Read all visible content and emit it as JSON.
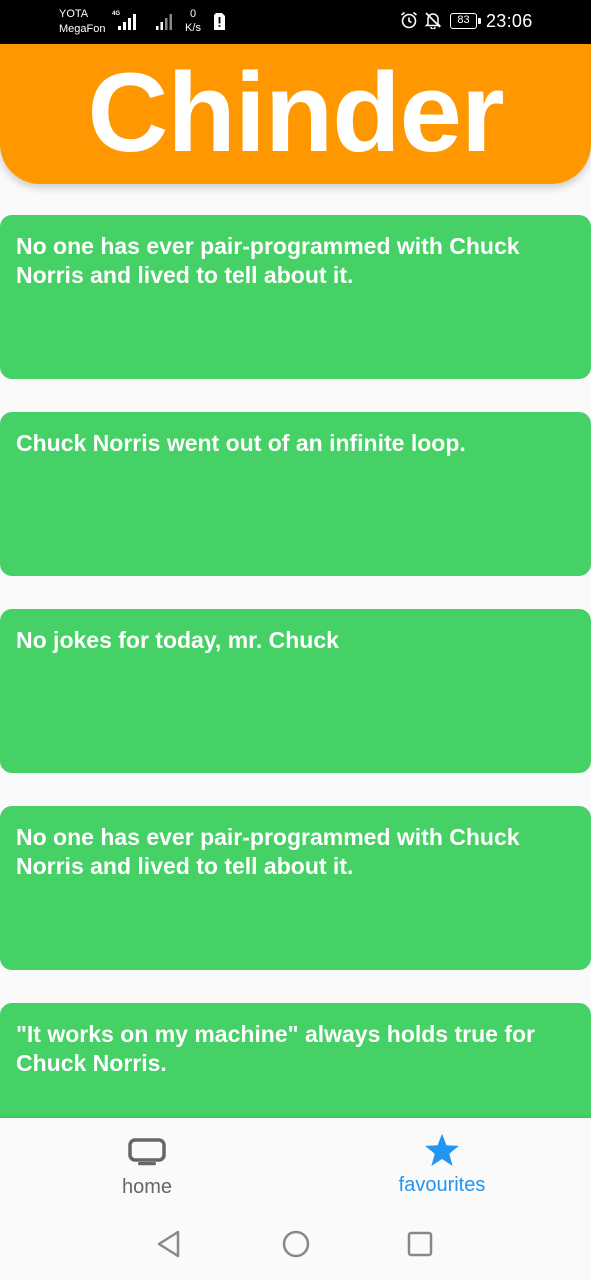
{
  "status_bar": {
    "carrier_1": "YOTA",
    "carrier_2": "MegaFon",
    "network_type": "4G",
    "speed_value": "0",
    "speed_unit": "K/s",
    "battery": "83",
    "time": "23:06",
    "icons": [
      "signal-icon",
      "sim-alert-icon",
      "alarm-icon",
      "bell-off-icon",
      "battery-icon"
    ]
  },
  "header": {
    "title": "Chinder",
    "color": "#ff9800"
  },
  "jokes": [
    {
      "text": "No one has ever pair-programmed with Chuck Norris and lived to tell about it."
    },
    {
      "text": "Chuck Norris went out of an infinite loop."
    },
    {
      "text": "No jokes for today, mr. Chuck"
    },
    {
      "text": "No one has ever pair-programmed with Chuck Norris and lived to tell about it."
    },
    {
      "text": "\"It works on my machine\" always holds true for Chuck Norris."
    }
  ],
  "card_color": "#45d165",
  "bottom_nav": {
    "items": [
      {
        "label": "home",
        "icon": "tv-icon",
        "active": false
      },
      {
        "label": "favourites",
        "icon": "star-icon",
        "active": true
      }
    ],
    "active_color": "#2196f3"
  },
  "system_nav": {
    "buttons": [
      "back-icon",
      "home-circle-icon",
      "recents-icon"
    ]
  }
}
